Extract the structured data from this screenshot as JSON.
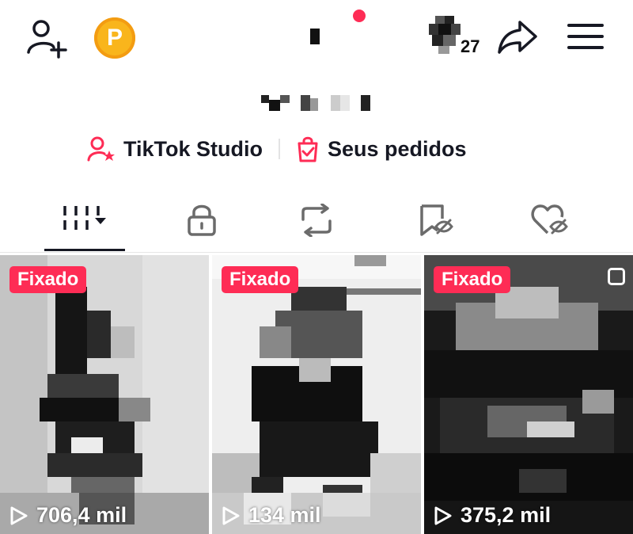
{
  "header": {
    "coin_letter": "P",
    "avatar_badge": "27"
  },
  "links": {
    "studio_label": "TikTok Studio",
    "orders_label": "Seus pedidos"
  },
  "tabs": [
    {
      "icon": "grid-icon",
      "active": true
    },
    {
      "icon": "lock-icon"
    },
    {
      "icon": "repost-icon"
    },
    {
      "icon": "bookmark-icon"
    },
    {
      "icon": "liked-icon"
    }
  ],
  "videos": [
    {
      "badge": "Fixado",
      "views": "706,4 mil"
    },
    {
      "badge": "Fixado",
      "views": "134 mil"
    },
    {
      "badge": "Fixado",
      "views": "375,2 mil"
    }
  ],
  "colors": {
    "accent": "#fe2c55",
    "coin": "#f9b51c",
    "text": "#161823"
  }
}
